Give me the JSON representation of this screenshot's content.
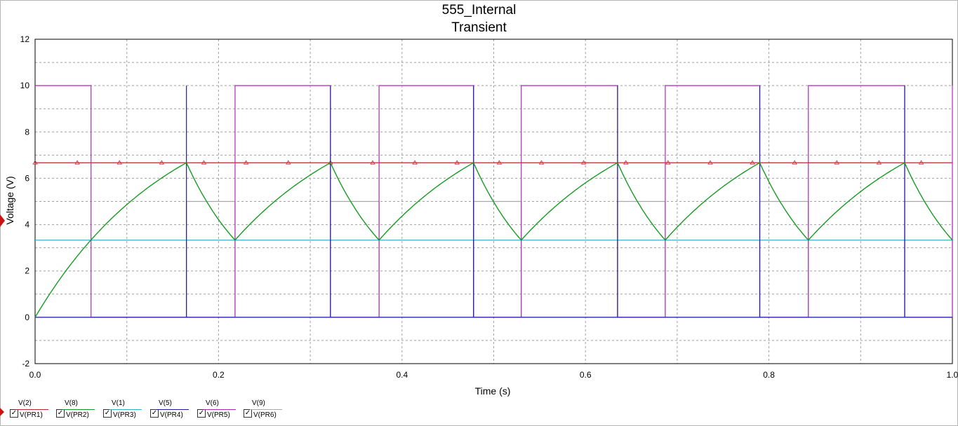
{
  "chart_data": {
    "type": "line",
    "title": "555_Internal",
    "subtitle": "Transient",
    "xlabel": "Time (s)",
    "ylabel": "Voltage (V)",
    "xlim": [
      0.0,
      1.0
    ],
    "ylim": [
      -2,
      12
    ],
    "grid": true,
    "legend_position": "bottom-left",
    "x_ticks": [
      "0.0",
      "0.2",
      "0.4",
      "0.6",
      "0.8",
      "1.0"
    ],
    "y_ticks": [
      "-2",
      "0",
      "2",
      "4",
      "6",
      "8",
      "10",
      "12"
    ],
    "timing": {
      "charge_end": [
        0.165,
        0.322,
        0.478,
        0.635,
        0.79,
        0.948
      ],
      "discharge_end": [
        0.218,
        0.375,
        0.53,
        0.687,
        0.843,
        1.0
      ],
      "first_crossing": 0.061
    },
    "series": [
      {
        "name": "V(2)",
        "probe": "V(PR1)",
        "color": "#c0282c",
        "kind": "threshold",
        "value": 6.67
      },
      {
        "name": "V(8)",
        "probe": "V(PR2)",
        "color": "#179b22",
        "kind": "capacitor",
        "low": 3.33,
        "high": 6.67
      },
      {
        "name": "V(1)",
        "probe": "V(PR3)",
        "color": "#36b3c7",
        "kind": "constant",
        "value": 3.33
      },
      {
        "name": "V(5)",
        "probe": "V(PR4)",
        "color": "#1c1ca8",
        "kind": "spikes",
        "low": 0,
        "high": 10
      },
      {
        "name": "V(6)",
        "probe": "V(PR5)",
        "color": "#b02ab8",
        "kind": "output",
        "low": 0,
        "high": 10
      },
      {
        "name": "V(9)",
        "probe": "V(PR6)",
        "color": "#a8a8a8",
        "kind": "state",
        "low": 0,
        "high": 5
      }
    ]
  }
}
